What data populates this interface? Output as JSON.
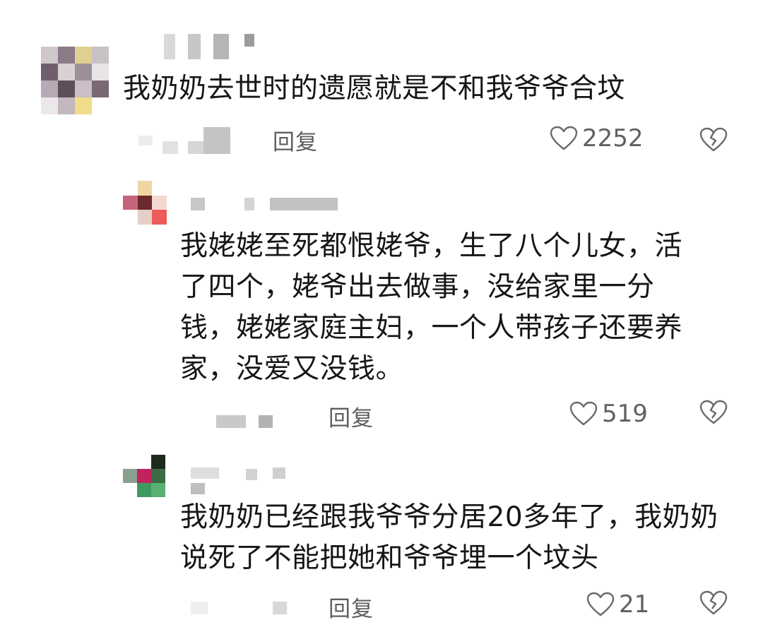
{
  "comments": [
    {
      "text": "我奶奶去世时的遗愿就是不和我爷爷合坟",
      "reply_label": "回复",
      "like_count": "2252",
      "like_icon": "heart-outline-icon",
      "dislike_icon": "broken-heart-icon"
    },
    {
      "text": "我姥姥至死都恨姥爷，生了八个儿女，活了四个，姥爷出去做事，没给家里一分钱，姥姥家庭主妇，一个人带孩子还要养家，没爱又没钱。",
      "reply_label": "回复",
      "like_count": "519",
      "like_icon": "heart-outline-icon",
      "dislike_icon": "broken-heart-icon"
    },
    {
      "text": "我奶奶已经跟我爷爷分居20多年了，我奶奶说死了不能把她和爷爷埋一个坟头",
      "reply_label": "回复",
      "like_count": "21",
      "like_icon": "heart-outline-icon",
      "dislike_icon": "broken-heart-icon"
    }
  ],
  "colors": {
    "text": "#161616",
    "secondary": "#5e5e5e",
    "background": "#ffffff"
  }
}
